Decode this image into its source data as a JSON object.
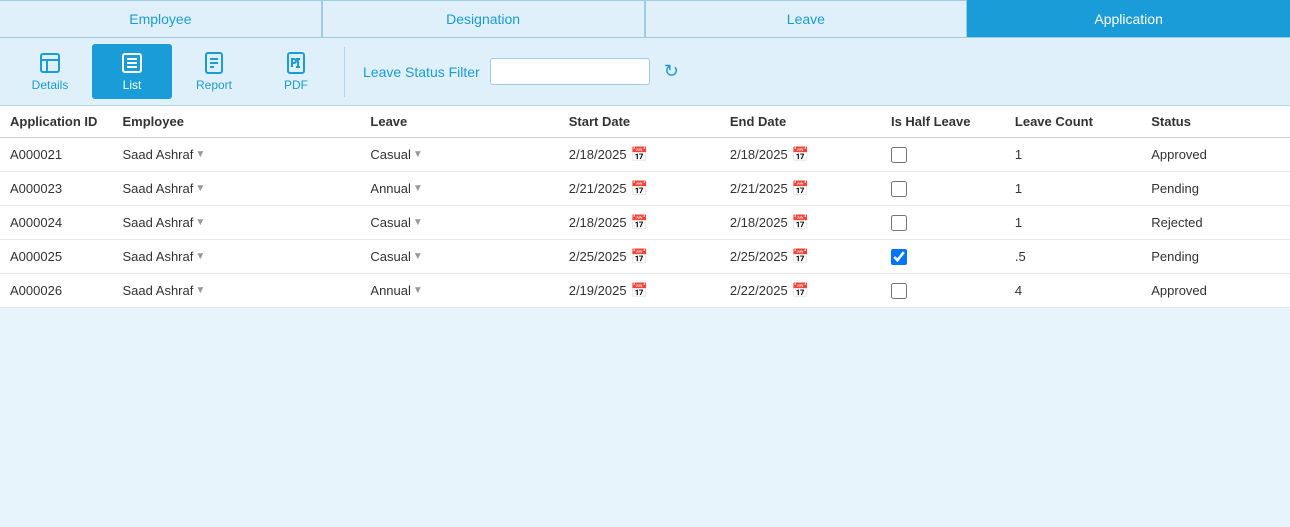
{
  "nav": {
    "tabs": [
      {
        "id": "employee",
        "label": "Employee",
        "active": false
      },
      {
        "id": "designation",
        "label": "Designation",
        "active": false
      },
      {
        "id": "leave",
        "label": "Leave",
        "active": false
      },
      {
        "id": "application",
        "label": "Application",
        "active": true
      }
    ]
  },
  "toolbar": {
    "buttons": [
      {
        "id": "details",
        "label": "Details",
        "active": false
      },
      {
        "id": "list",
        "label": "List",
        "active": true
      },
      {
        "id": "report",
        "label": "Report",
        "active": false
      },
      {
        "id": "pdf",
        "label": "PDF",
        "active": false
      }
    ],
    "filter_label": "Leave Status Filter",
    "filter_placeholder": "",
    "refresh_icon": "↻"
  },
  "table": {
    "columns": [
      "Application ID",
      "Employee",
      "Leave",
      "Start Date",
      "End Date",
      "Is Half Leave",
      "Leave Count",
      "Status"
    ],
    "rows": [
      {
        "app_id": "A000021",
        "employee": "Saad Ashraf",
        "leave": "Casual",
        "start_date": "2/18/2025",
        "end_date": "2/18/2025",
        "is_half_leave": false,
        "leave_count": "1",
        "status": "Approved"
      },
      {
        "app_id": "A000023",
        "employee": "Saad Ashraf",
        "leave": "Annual",
        "start_date": "2/21/2025",
        "end_date": "2/21/2025",
        "is_half_leave": false,
        "leave_count": "1",
        "status": "Pending"
      },
      {
        "app_id": "A000024",
        "employee": "Saad Ashraf",
        "leave": "Casual",
        "start_date": "2/18/2025",
        "end_date": "2/18/2025",
        "is_half_leave": false,
        "leave_count": "1",
        "status": "Rejected"
      },
      {
        "app_id": "A000025",
        "employee": "Saad Ashraf",
        "leave": "Casual",
        "start_date": "2/25/2025",
        "end_date": "2/25/2025",
        "is_half_leave": true,
        "leave_count": ".5",
        "status": "Pending"
      },
      {
        "app_id": "A000026",
        "employee": "Saad Ashraf",
        "leave": "Annual",
        "start_date": "2/19/2025",
        "end_date": "2/22/2025",
        "is_half_leave": false,
        "leave_count": "4",
        "status": "Approved"
      }
    ]
  },
  "colors": {
    "primary": "#1a9cd8",
    "light_bg": "#dff0fa",
    "border": "#a0cce0"
  }
}
